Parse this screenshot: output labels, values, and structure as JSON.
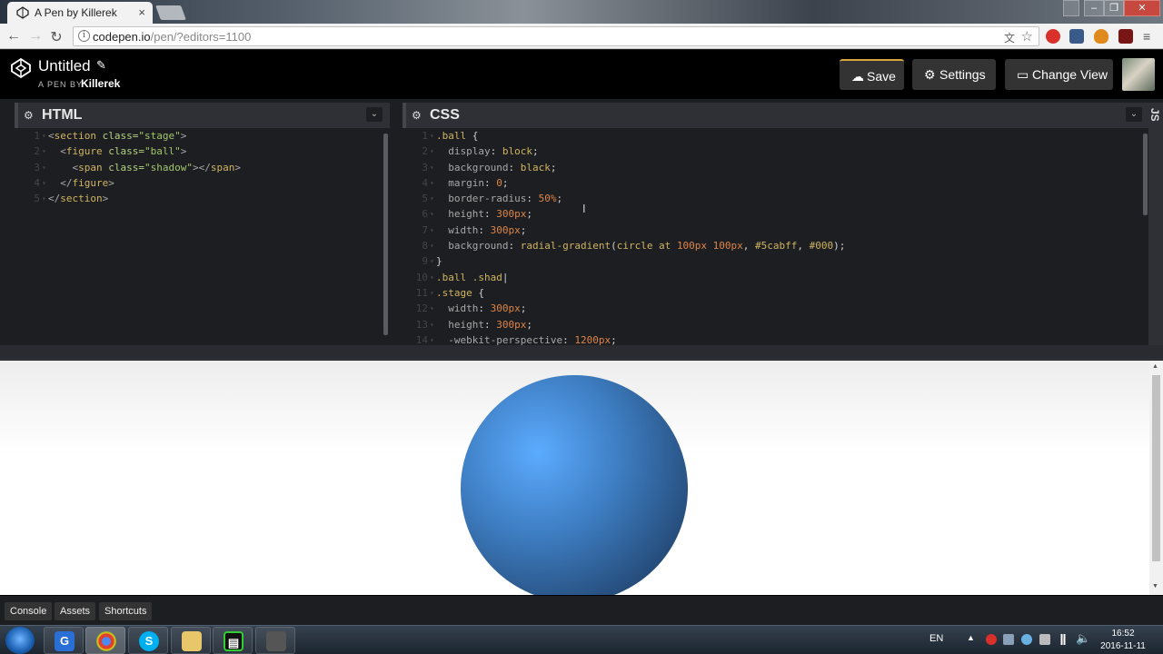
{
  "browser": {
    "tab_title": "A Pen by Killerek",
    "tab_close": "×",
    "window_controls": [
      "–",
      "❐",
      "✕"
    ],
    "url_main": "codepen.io",
    "url_rest": "/pen/?editors=1100",
    "nav": {
      "back": "←",
      "forward": "→",
      "reload": "↻"
    }
  },
  "header": {
    "title": "Untitled",
    "pen_by": "A PEN BY",
    "author": "Killerek",
    "save_label": "Save",
    "settings_label": "Settings",
    "change_view_label": "Change View"
  },
  "html_editor": {
    "title": "HTML",
    "lines": [
      {
        "n": "1",
        "parts": [
          [
            "t-tag",
            "<"
          ],
          [
            "t-el",
            "section"
          ],
          [
            "t-attr",
            " class="
          ],
          [
            "t-str",
            "\"stage\""
          ],
          [
            "t-tag",
            ">"
          ]
        ]
      },
      {
        "n": "2",
        "parts": [
          [
            "t-tag",
            "  <"
          ],
          [
            "t-el",
            "figure"
          ],
          [
            "t-attr",
            " class="
          ],
          [
            "t-str",
            "\"ball\""
          ],
          [
            "t-tag",
            ">"
          ]
        ]
      },
      {
        "n": "3",
        "parts": [
          [
            "t-tag",
            "    <"
          ],
          [
            "t-el",
            "span"
          ],
          [
            "t-attr",
            " class="
          ],
          [
            "t-str",
            "\"shadow\""
          ],
          [
            "t-tag",
            "></"
          ],
          [
            "t-el",
            "span"
          ],
          [
            "t-tag",
            ">"
          ]
        ]
      },
      {
        "n": "4",
        "parts": [
          [
            "t-tag",
            "  </"
          ],
          [
            "t-el",
            "figure"
          ],
          [
            "t-tag",
            ">"
          ]
        ]
      },
      {
        "n": "5",
        "parts": [
          [
            "t-tag",
            "</"
          ],
          [
            "t-el",
            "section"
          ],
          [
            "t-tag",
            ">"
          ]
        ]
      }
    ]
  },
  "css_editor": {
    "title": "CSS",
    "lines": [
      {
        "n": "1",
        "parts": [
          [
            "t-sel",
            ".ball"
          ],
          [
            "t-punc",
            " {"
          ]
        ]
      },
      {
        "n": "2",
        "parts": [
          [
            "t-prop",
            "  display"
          ],
          [
            "t-punc",
            ": "
          ],
          [
            "t-val",
            "block"
          ],
          [
            "t-punc",
            ";"
          ]
        ]
      },
      {
        "n": "3",
        "parts": [
          [
            "t-prop",
            "  background"
          ],
          [
            "t-punc",
            ": "
          ],
          [
            "t-val",
            "black"
          ],
          [
            "t-punc",
            ";"
          ]
        ]
      },
      {
        "n": "4",
        "parts": [
          [
            "t-prop",
            "  margin"
          ],
          [
            "t-punc",
            ": "
          ],
          [
            "t-num",
            "0"
          ],
          [
            "t-punc",
            ";"
          ]
        ]
      },
      {
        "n": "5",
        "parts": [
          [
            "t-prop",
            "  border-radius"
          ],
          [
            "t-punc",
            ": "
          ],
          [
            "t-num",
            "50%"
          ],
          [
            "t-punc",
            ";"
          ]
        ]
      },
      {
        "n": "6",
        "parts": [
          [
            "t-prop",
            "  height"
          ],
          [
            "t-punc",
            ": "
          ],
          [
            "t-num",
            "300px"
          ],
          [
            "t-punc",
            ";"
          ]
        ]
      },
      {
        "n": "7",
        "parts": [
          [
            "t-prop",
            "  width"
          ],
          [
            "t-punc",
            ": "
          ],
          [
            "t-num",
            "300px"
          ],
          [
            "t-punc",
            ";"
          ]
        ]
      },
      {
        "n": "8",
        "parts": [
          [
            "t-prop",
            "  background"
          ],
          [
            "t-punc",
            ": "
          ],
          [
            "t-fn",
            "radial-gradient"
          ],
          [
            "t-punc",
            "("
          ],
          [
            "t-val",
            "circle at "
          ],
          [
            "t-num",
            "100px 100px"
          ],
          [
            "t-punc",
            ", "
          ],
          [
            "t-val",
            "#5cabff"
          ],
          [
            "t-punc",
            ", "
          ],
          [
            "t-val",
            "#000"
          ],
          [
            "t-punc",
            ");"
          ]
        ]
      },
      {
        "n": "9",
        "parts": [
          [
            "t-punc",
            "}"
          ]
        ]
      },
      {
        "n": "10",
        "parts": [
          [
            "t-sel",
            ".ball .shad"
          ],
          [
            "t-punc",
            "|"
          ]
        ]
      },
      {
        "n": "11",
        "parts": [
          [
            "t-sel",
            ".stage"
          ],
          [
            "t-punc",
            " {"
          ]
        ]
      },
      {
        "n": "12",
        "parts": [
          [
            "t-prop",
            "  width"
          ],
          [
            "t-punc",
            ": "
          ],
          [
            "t-num",
            "300px"
          ],
          [
            "t-punc",
            ";"
          ]
        ]
      },
      {
        "n": "13",
        "parts": [
          [
            "t-prop",
            "  height"
          ],
          [
            "t-punc",
            ": "
          ],
          [
            "t-num",
            "300px"
          ],
          [
            "t-punc",
            ";"
          ]
        ]
      },
      {
        "n": "14",
        "parts": [
          [
            "t-prop",
            "  -webkit-perspective"
          ],
          [
            "t-punc",
            ": "
          ],
          [
            "t-num",
            "1200px"
          ],
          [
            "t-punc",
            ";"
          ]
        ]
      }
    ]
  },
  "js_tab_label": "JS",
  "footer": {
    "console_label": "Console",
    "assets_label": "Assets",
    "shortcuts_label": "Shortcuts"
  },
  "taskbar": {
    "language": "EN",
    "time": "16:52",
    "date": "2016-11-11"
  },
  "colors": {
    "ball_highlight": "#5cabff",
    "save_accent": "#d7a53b",
    "editor_bg": "#1d1e22"
  }
}
